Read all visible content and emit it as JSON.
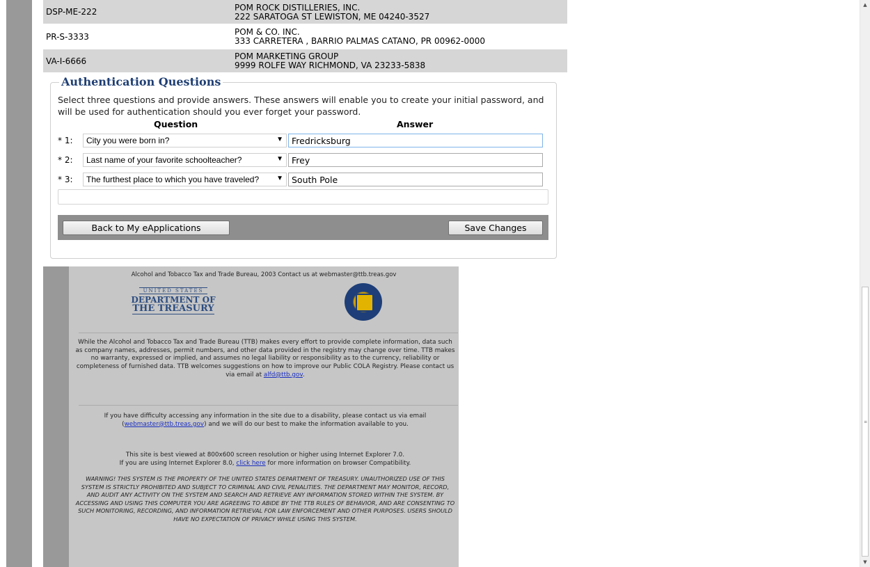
{
  "permits": [
    {
      "id": "DSP-ME-222",
      "name": "POM ROCK DISTILLERIES, INC.",
      "address": "222 SARATOGA ST LEWISTON, ME 04240-3527",
      "shade": true
    },
    {
      "id": "PR-S-3333",
      "name": "POM & CO. INC.",
      "address": "333 CARRETERA , BARRIO PALMAS CATANO, PR 00962-0000",
      "shade": false
    },
    {
      "id": "VA-I-6666",
      "name": "POM MARKETING GROUP",
      "address": "9999 ROLFE WAY RICHMOND, VA 23233-5838",
      "shade": true
    }
  ],
  "auth": {
    "title": "Authentication Questions",
    "description": "Select three questions and provide answers. These answers will enable you to create your initial password, and will be used for authentication should you ever forget your password.",
    "question_header": "Question",
    "answer_header": "Answer",
    "rows": [
      {
        "num": "* 1:",
        "question": "City you were born in?",
        "answer": "Fredricksburg"
      },
      {
        "num": "* 2:",
        "question": "Last name of your favorite schoolteacher?",
        "answer": "Frey"
      },
      {
        "num": "* 3:",
        "question": "The furthest place to which you have traveled?",
        "answer": "South Pole"
      }
    ],
    "back_label": "Back to My eApplications",
    "save_label": "Save Changes"
  },
  "footer": {
    "line1": "Alcohol and Tobacco Tax and Trade Bureau, 2003  Contact us at webmaster@ttb.treas.gov",
    "treasury_line1": "UNITED STATES",
    "treasury_line2": "DEPARTMENT OF",
    "treasury_line3": "THE TREASURY",
    "disclaimer_text": "While the Alcohol and Tobacco Tax and Trade Bureau (TTB) makes every effort to provide complete information, data such as company names, addresses, permit numbers, and other data provided in the registry may change over time. TTB makes no warranty, expressed or implied, and assumes no legal liability or responsibility as to the currency, reliability or completeness of furnished data. TTB welcomes suggestions on how to improve our Public COLA Registry. Please contact us via email at",
    "disclaimer_link": "alfd@ttb.gov",
    "access_pre": "If you have difficulty accessing any information in the site due to a disability, please contact us via email (",
    "access_link": "webmaster@ttb.treas.gov",
    "access_post": ") and we will do our best to make the information available to you.",
    "best_viewed": "This site is best viewed at 800x600 screen resolution or higher using Internet Explorer 7.0.",
    "ie8_pre": "If you are using Internet Explorer 8.0,",
    "ie8_link": "click here",
    "ie8_post": "for more information on browser Compatibility.",
    "warning": "WARNING! THIS SYSTEM IS THE PROPERTY OF THE UNITED STATES DEPARTMENT OF TREASURY. UNAUTHORIZED USE OF THIS SYSTEM IS STRICTLY PROHIBITED AND SUBJECT TO CRIMINAL AND CIVIL PENALITIES. THE DEPARTMENT MAY MONITOR, RECORD, AND AUDIT ANY ACTIVITY ON THE SYSTEM AND SEARCH AND RETRIEVE ANY INFORMATION STORED WITHIN THE SYSTEM. BY ACCESSING AND USING THIS COMPUTER YOU ARE AGREEING TO ABIDE BY THE TTB RULES OF BEHAVIOR, AND ARE CONSENTING TO SUCH MONITORING, RECORDING, AND INFORMATION RETRIEVAL FOR LAW ENFORCEMENT AND OTHER PURPOSES. USERS SHOULD HAVE NO EXPECTATION OF PRIVACY WHILE USING THIS SYSTEM."
  },
  "icons": {
    "select_arrow": "chevron-down-icon",
    "scroll_up": "scroll-up-arrow-icon",
    "scroll_down": "scroll-down-arrow-icon"
  }
}
